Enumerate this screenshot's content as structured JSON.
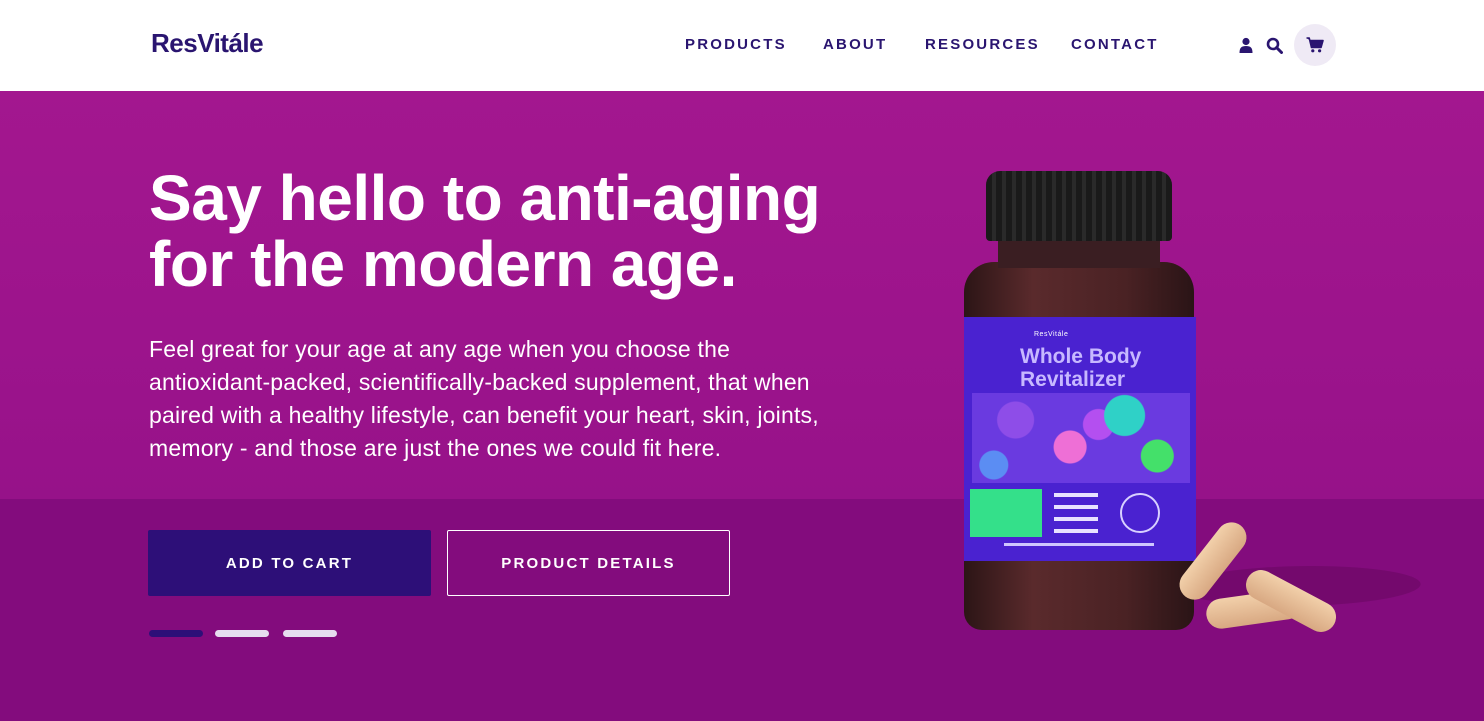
{
  "brand": {
    "logo": "ResVitále"
  },
  "nav": {
    "items": [
      {
        "label": "PRODUCTS"
      },
      {
        "label": "ABOUT"
      },
      {
        "label": "RESOURCES"
      },
      {
        "label": "CONTACT"
      }
    ],
    "icons": [
      "user-icon",
      "search-icon",
      "cart-icon"
    ]
  },
  "hero": {
    "headline": "Say hello to anti-aging for the modern age.",
    "body": "Feel great for your age at any age when you choose the antioxidant-packed,  scientifically-backed supplement, that when paired with a healthy lifestyle, can benefit your heart, skin, joints, memory - and those are just the ones we could fit here.",
    "primary_cta": "ADD TO CART",
    "secondary_cta": "PRODUCT DETAILS",
    "slides": {
      "count": 3,
      "active_index": 0
    },
    "product": {
      "label_brand": "ResVitále",
      "label_title_line1": "Whole Body",
      "label_title_line2": "Revitalizer"
    }
  },
  "colors": {
    "brand_navy": "#2a1570",
    "hero_magenta": "#a3178f",
    "button_primary": "#2d0f78",
    "text_on_hero": "#ffffff"
  }
}
